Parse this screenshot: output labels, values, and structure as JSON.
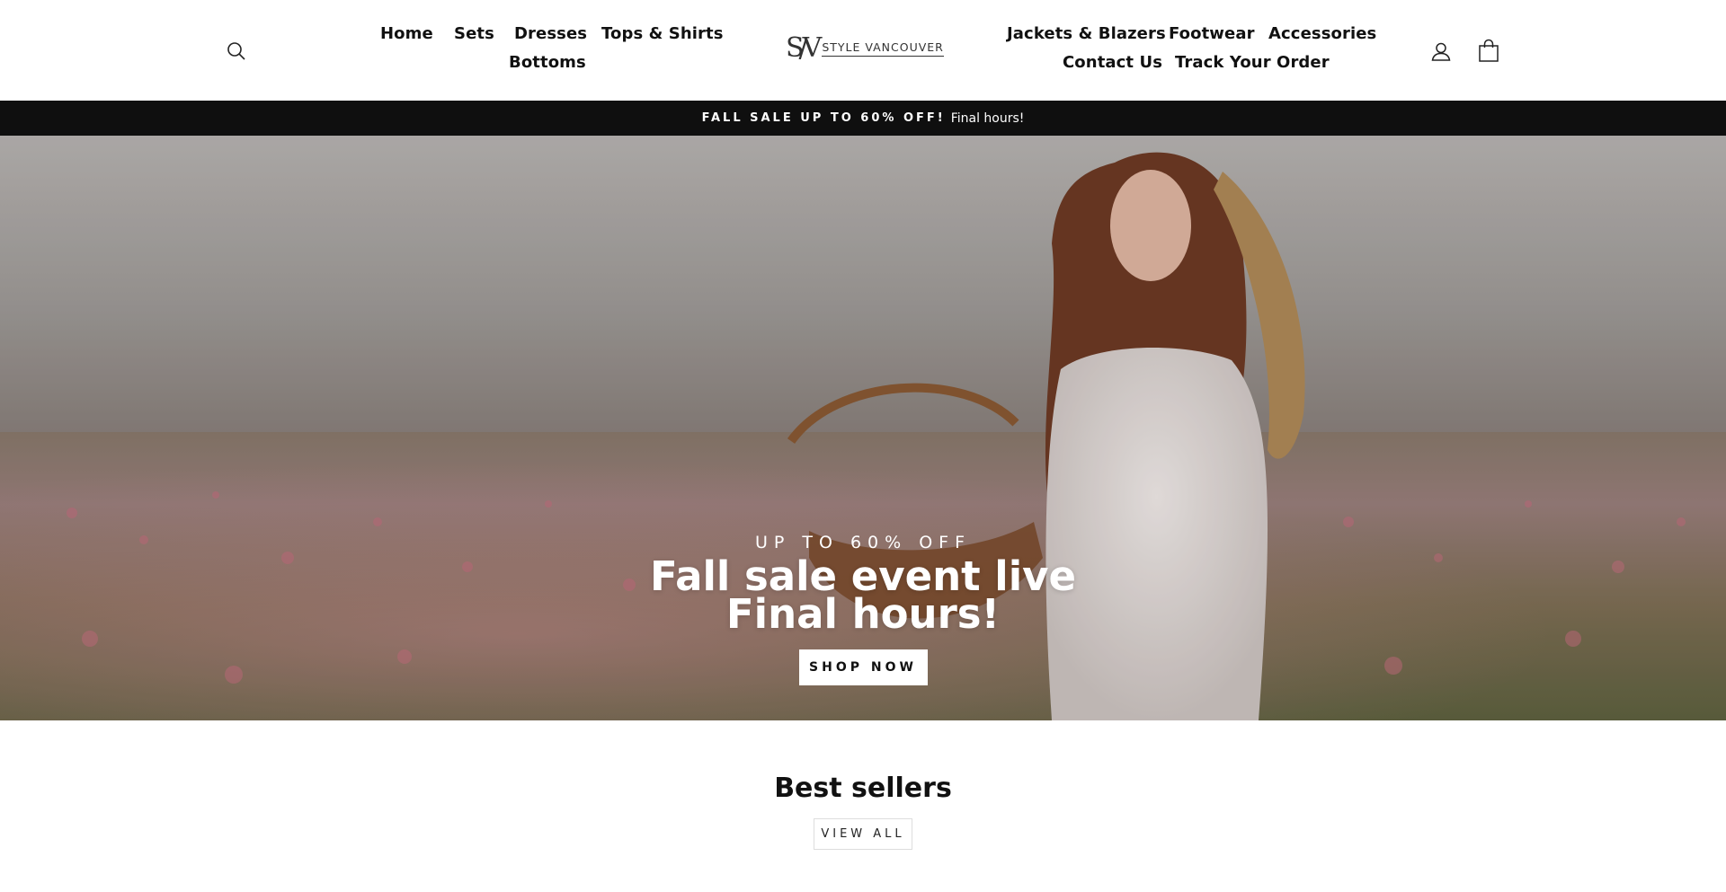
{
  "header": {
    "logo": {
      "mark": "S/V",
      "text": "STYLE VANCOUVER"
    },
    "nav_left": [
      "Home",
      "Sets",
      "Dresses",
      "Tops & Shirts",
      "Bottoms"
    ],
    "nav_right": [
      "Jackets & Blazers",
      "Footwear",
      "Accessories",
      "Contact Us",
      "Track Your Order"
    ],
    "icons": {
      "search": "search-icon",
      "account": "user-icon",
      "cart": "cart-icon"
    }
  },
  "announcement": {
    "bold": "FALL SALE UP TO 60% OFF!",
    "text": "Final hours!"
  },
  "hero": {
    "eyebrow": "UP TO 60% OFF",
    "title_line1": "Fall sale event live",
    "title_line2": "Final hours!",
    "button": "SHOP NOW"
  },
  "best_sellers": {
    "title": "Best sellers",
    "button": "VIEW ALL"
  },
  "colors": {
    "announce_bg": "#0f0f0f",
    "text": "#111111",
    "accent": "#ffffff"
  }
}
